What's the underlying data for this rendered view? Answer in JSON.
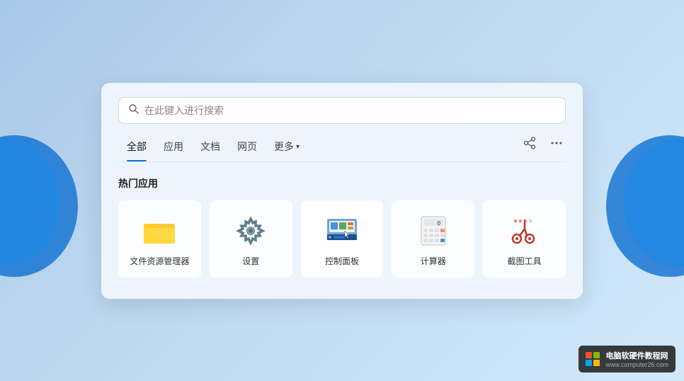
{
  "background": {
    "color_start": "#a8c8e8",
    "color_end": "#d0e8f8"
  },
  "search": {
    "placeholder": "在此键入进行搜索",
    "icon": "search-icon"
  },
  "tabs": [
    {
      "id": "all",
      "label": "全部",
      "active": true
    },
    {
      "id": "apps",
      "label": "应用",
      "active": false
    },
    {
      "id": "docs",
      "label": "文档",
      "active": false
    },
    {
      "id": "web",
      "label": "网页",
      "active": false
    },
    {
      "id": "more",
      "label": "更多",
      "active": false,
      "has_arrow": true
    }
  ],
  "tab_actions": {
    "share_label": "⊕",
    "more_label": "···"
  },
  "section": {
    "title": "热门应用"
  },
  "apps": [
    {
      "id": "file-manager",
      "label": "文件资源管理器",
      "icon": "folder"
    },
    {
      "id": "settings",
      "label": "设置",
      "icon": "gear"
    },
    {
      "id": "control-panel",
      "label": "控制面板",
      "icon": "control-panel"
    },
    {
      "id": "calculator",
      "label": "计算器",
      "icon": "calculator"
    },
    {
      "id": "snipping-tool",
      "label": "截图工具",
      "icon": "scissors"
    }
  ],
  "watermark": {
    "title": "电脑软硬件教程网",
    "url": "www.computer26.com"
  }
}
